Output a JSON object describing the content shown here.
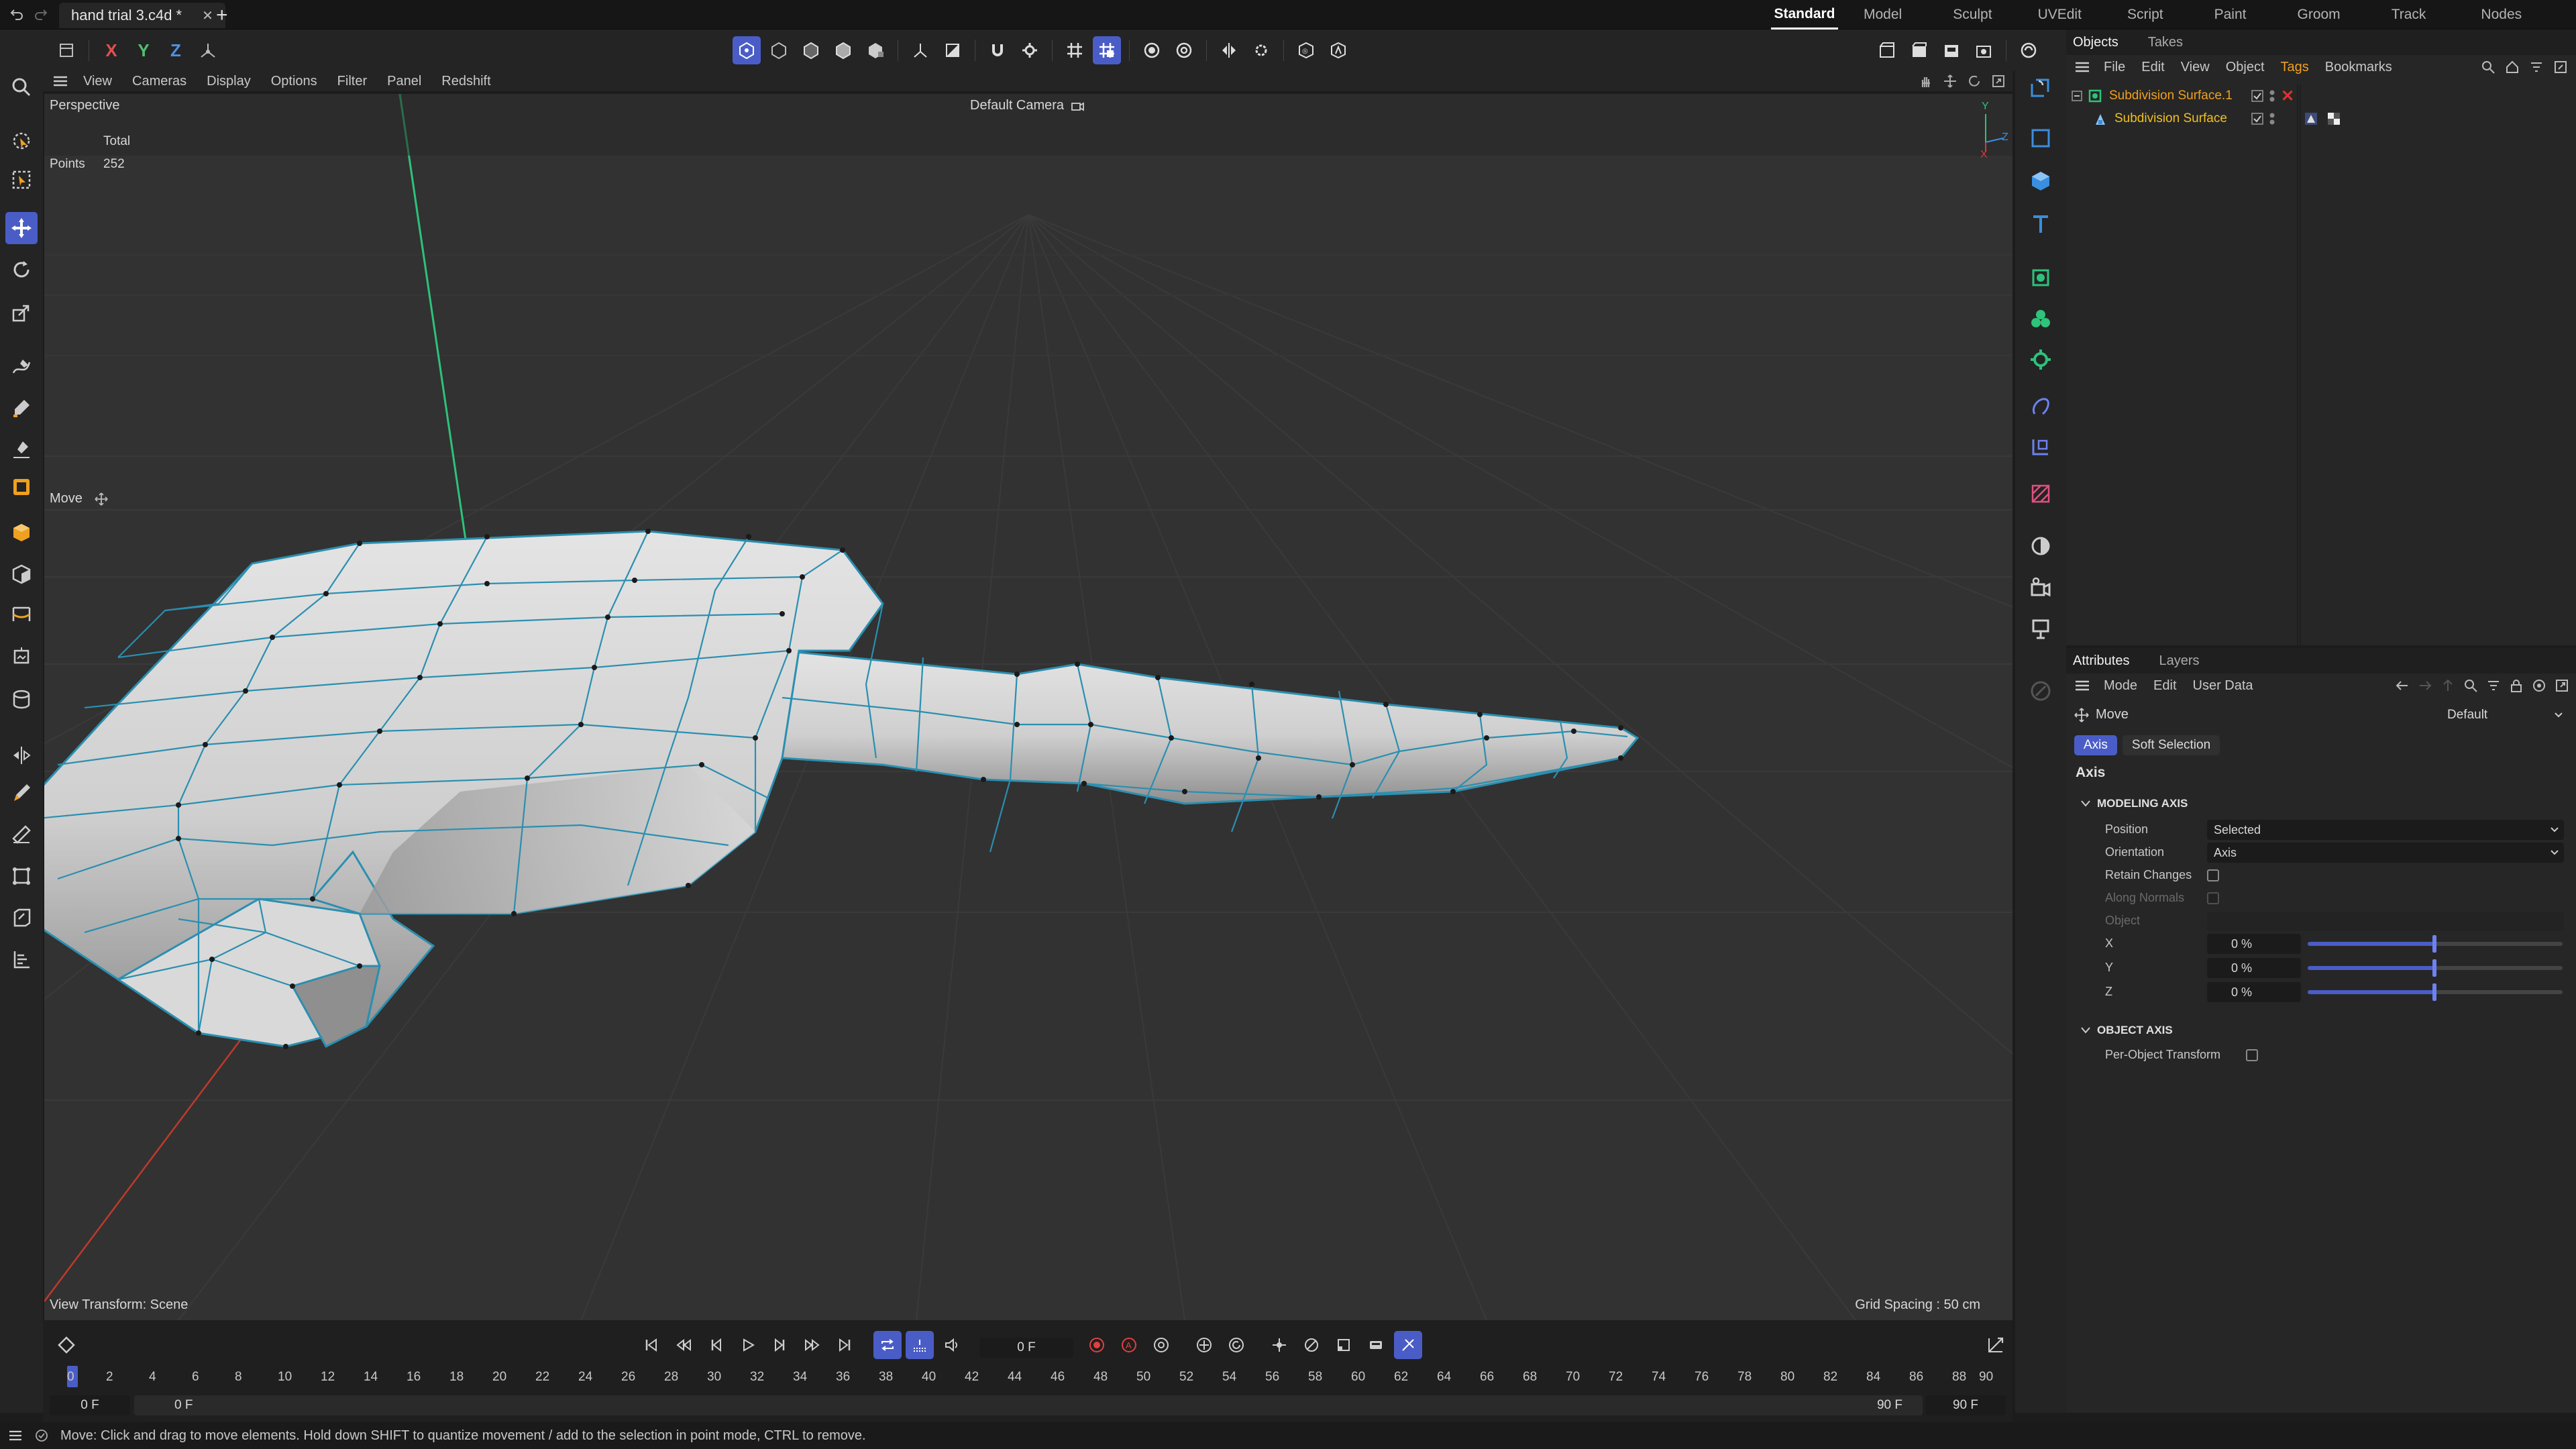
{
  "titlebar": {
    "doc_tab": "hand trial 3.c4d *",
    "layouts": [
      "Standard",
      "Model",
      "Sculpt",
      "UVEdit",
      "Script",
      "Paint",
      "Groom",
      "Track",
      "Nodes"
    ],
    "active_layout": "Standard"
  },
  "toolbar": {
    "axis_x": "X",
    "axis_y": "Y",
    "axis_z": "Z"
  },
  "viewport_menu": [
    "View",
    "Cameras",
    "Display",
    "Options",
    "Filter",
    "Panel",
    "Redshift"
  ],
  "viewport": {
    "view_name": "Perspective",
    "camera": "Default Camera",
    "hud_total": "Total",
    "hud_points_label": "Points",
    "hud_points_value": "252",
    "tool_label": "Move",
    "view_transform": "View Transform: Scene",
    "grid_spacing": "Grid Spacing : 50 cm",
    "axis_y": "Y",
    "axis_z": "Z",
    "axis_x": "X"
  },
  "objects_panel": {
    "tabs": [
      "Objects",
      "Takes"
    ],
    "menu": [
      "File",
      "Edit",
      "View",
      "Object",
      "Tags",
      "Bookmarks"
    ],
    "active_menu": "Tags",
    "items": [
      {
        "name": "Subdivision Surface.1"
      },
      {
        "name": "Subdivision Surface"
      }
    ]
  },
  "attributes_panel": {
    "tabs": [
      "Attributes",
      "Layers"
    ],
    "menu": [
      "Mode",
      "Edit",
      "User Data"
    ],
    "tool_name": "Move",
    "preset": "Default",
    "subtabs": [
      "Axis",
      "Soft Selection"
    ],
    "section_title": "Axis",
    "modeling_axis": {
      "title": "MODELING AXIS",
      "position_label": "Position",
      "position_value": "Selected",
      "orientation_label": "Orientation",
      "orientation_value": "Axis",
      "retain_changes": "Retain Changes",
      "along_normals": "Along Normals",
      "object": "Object",
      "x_label": "X",
      "x_value": "0 %",
      "y_label": "Y",
      "y_value": "0 %",
      "z_label": "Z",
      "z_value": "0 %"
    },
    "object_axis": {
      "title": "OBJECT AXIS",
      "per_object": "Per-Object Transform"
    }
  },
  "timeline": {
    "current_frame": "0 F",
    "ruler": [
      "0",
      "2",
      "4",
      "6",
      "8",
      "10",
      "12",
      "14",
      "16",
      "18",
      "20",
      "22",
      "24",
      "26",
      "28",
      "30",
      "32",
      "34",
      "36",
      "38",
      "40",
      "42",
      "44",
      "46",
      "48",
      "50",
      "52",
      "54",
      "56",
      "58",
      "60",
      "62",
      "64",
      "66",
      "68",
      "70",
      "72",
      "74",
      "76",
      "78",
      "80",
      "82",
      "84",
      "86",
      "88",
      "90"
    ],
    "start_a": "0 F",
    "start_b": "0 F",
    "end_a": "90 F",
    "end_b": "90 F"
  },
  "status": {
    "message": "Move: Click and drag to move elements. Hold down SHIFT to quantize movement / add to the selection in point mode, CTRL to remove."
  },
  "colors": {
    "accent": "#4a5dc7",
    "object_orange": "#f0a020",
    "axis_red": "#d63a3a",
    "axis_green": "#2ec27a",
    "axis_blue": "#3a8ee0",
    "mesh_edge": "#2a8fb0"
  }
}
